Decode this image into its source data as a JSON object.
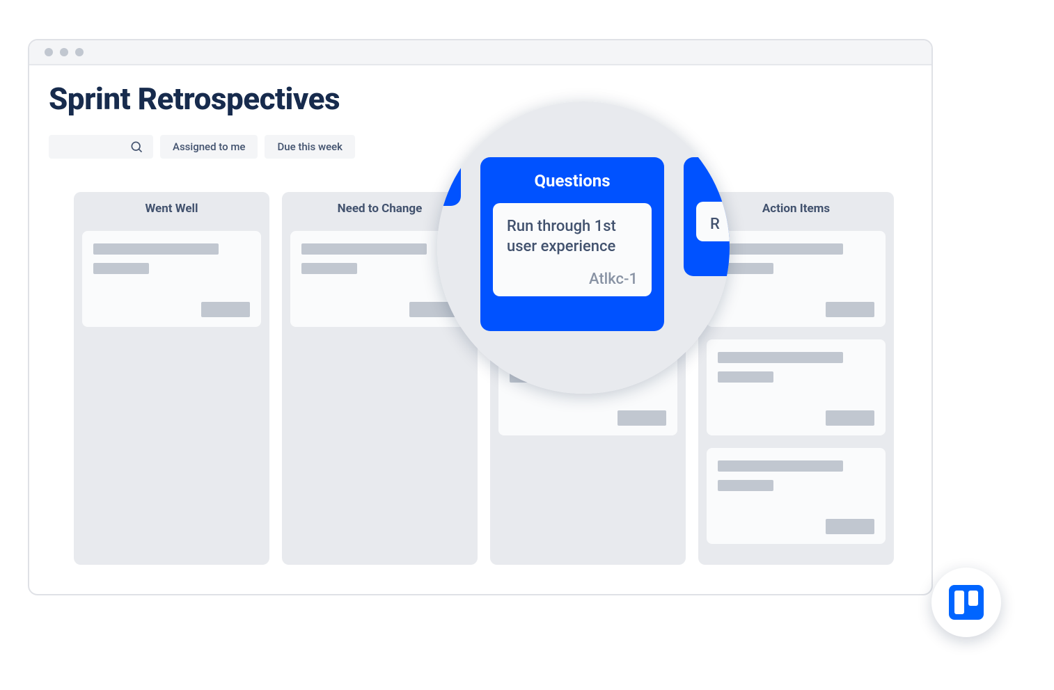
{
  "page": {
    "title": "Sprint Retrospectives"
  },
  "toolbar": {
    "assigned_label": "Assigned to me",
    "due_label": "Due this week"
  },
  "columns": [
    {
      "title": "Went Well",
      "cards": 1
    },
    {
      "title": "Need to Change",
      "cards": 1
    },
    {
      "title": "Questions",
      "cards": 2
    },
    {
      "title": "Action Items",
      "cards": 3
    }
  ],
  "lens": {
    "column_title": "Questions",
    "card_text": "Run through 1st user experience",
    "card_tag": "Atlkc-1",
    "right_peek": "R"
  }
}
